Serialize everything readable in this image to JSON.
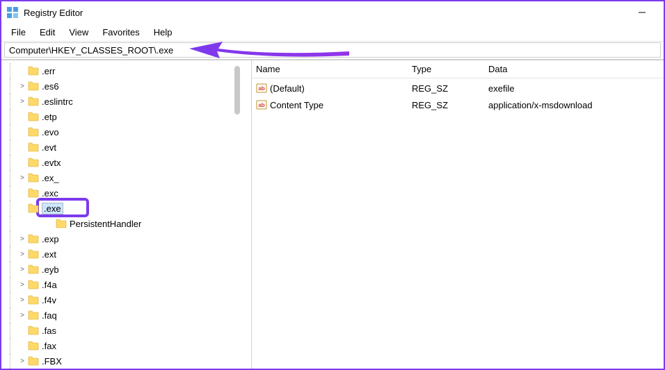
{
  "window": {
    "title": "Registry Editor"
  },
  "menu": {
    "file": "File",
    "edit": "Edit",
    "view": "View",
    "favorites": "Favorites",
    "help": "Help"
  },
  "address": {
    "value": "Computer\\HKEY_CLASSES_ROOT\\.exe"
  },
  "tree": {
    "items": [
      {
        "label": ".err",
        "depth": 3,
        "expander": ""
      },
      {
        "label": ".es6",
        "depth": 3,
        "expander": ">"
      },
      {
        "label": ".eslintrc",
        "depth": 3,
        "expander": ">"
      },
      {
        "label": ".etp",
        "depth": 3,
        "expander": ""
      },
      {
        "label": ".evo",
        "depth": 3,
        "expander": ""
      },
      {
        "label": ".evt",
        "depth": 3,
        "expander": ""
      },
      {
        "label": ".evtx",
        "depth": 3,
        "expander": ""
      },
      {
        "label": ".ex_",
        "depth": 3,
        "expander": ">"
      },
      {
        "label": ".exc",
        "depth": 3,
        "expander": ""
      },
      {
        "label": ".exe",
        "depth": 3,
        "expander": "",
        "selected": true,
        "highlighted": true
      },
      {
        "label": "PersistentHandler",
        "depth": 4,
        "expander": ""
      },
      {
        "label": ".exp",
        "depth": 3,
        "expander": ">"
      },
      {
        "label": ".ext",
        "depth": 3,
        "expander": ">"
      },
      {
        "label": ".eyb",
        "depth": 3,
        "expander": ">"
      },
      {
        "label": ".f4a",
        "depth": 3,
        "expander": ">"
      },
      {
        "label": ".f4v",
        "depth": 3,
        "expander": ">"
      },
      {
        "label": ".faq",
        "depth": 3,
        "expander": ">"
      },
      {
        "label": ".fas",
        "depth": 3,
        "expander": ""
      },
      {
        "label": ".fax",
        "depth": 3,
        "expander": ""
      },
      {
        "label": ".FBX",
        "depth": 3,
        "expander": ">"
      }
    ]
  },
  "list": {
    "headers": {
      "name": "Name",
      "type": "Type",
      "data": "Data"
    },
    "rows": [
      {
        "name": "(Default)",
        "type": "REG_SZ",
        "data": "exefile"
      },
      {
        "name": "Content Type",
        "type": "REG_SZ",
        "data": "application/x-msdownload"
      }
    ]
  }
}
